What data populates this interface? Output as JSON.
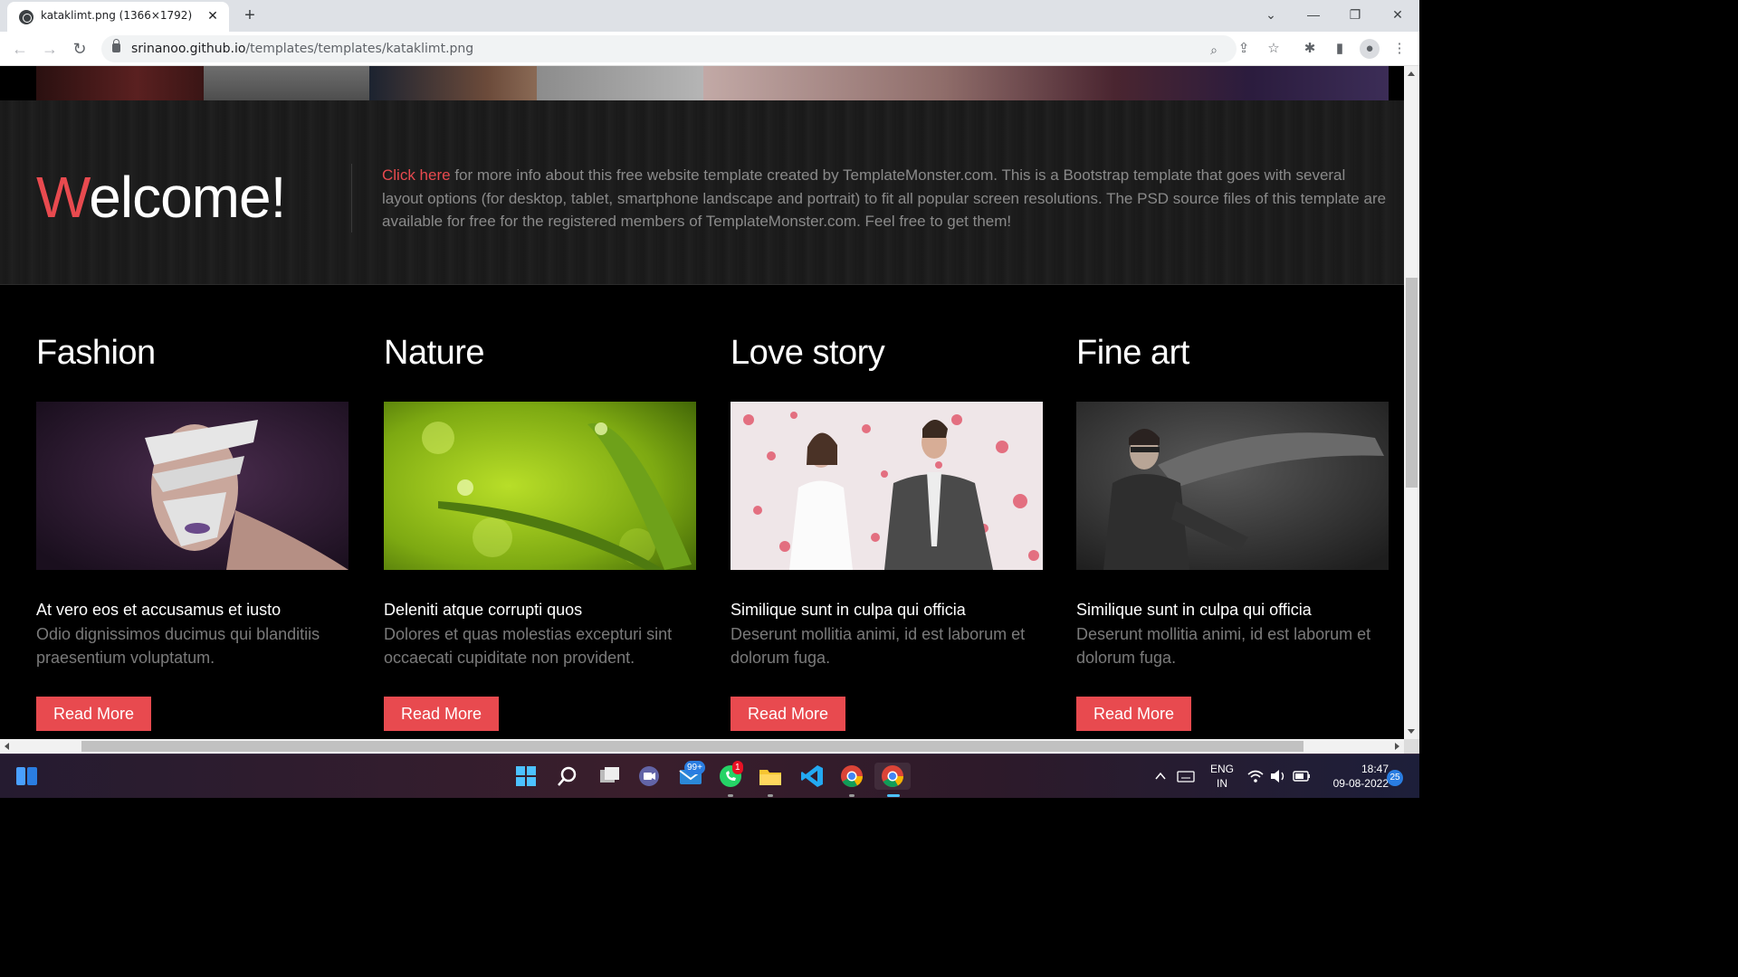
{
  "browser": {
    "tab_title": "kataklimt.png (1366×1792)",
    "url_host": "srinanoo.github.io",
    "url_path": "/templates/templates/kataklimt.png"
  },
  "welcome": {
    "title_first_letter": "W",
    "title_rest": "elcome!",
    "link_text": "Click here",
    "body_text": " for more info about this free website template created by TemplateMonster.com. This is a Bootstrap template that goes with several layout options (for desktop, tablet, smartphone landscape and portrait) to fit all popular screen resolutions. The PSD source files of this template are available for free for the registered members of TemplateMonster.com. Feel free to get them!"
  },
  "columns": [
    {
      "heading": "Fashion",
      "subtitle": "At vero eos et accusamus et iusto",
      "text": "Odio dignissimos ducimus qui blanditiis praesentium voluptatum.",
      "button": "Read More"
    },
    {
      "heading": "Nature",
      "subtitle": "Deleniti atque corrupti quos",
      "text": "Dolores et quas molestias excepturi sint occaecati cupiditate non provident.",
      "button": "Read More"
    },
    {
      "heading": "Love story",
      "subtitle": "Similique sunt in culpa qui officia",
      "text": "Deserunt mollitia animi, id est laborum et dolorum fuga.",
      "button": "Read More"
    },
    {
      "heading": "Fine art",
      "subtitle": "Similique sunt in culpa qui officia",
      "text": "Deserunt mollitia animi, id est laborum et dolorum fuga.",
      "button": "Read More"
    }
  ],
  "taskbar": {
    "mail_badge": "99+",
    "whatsapp_badge": "1",
    "lang_line1": "ENG",
    "lang_line2": "IN",
    "time": "18:47",
    "date": "09-08-2022",
    "notification_count": "25"
  },
  "colors": {
    "accent": "#e84a4f",
    "page_background": "#000000"
  }
}
